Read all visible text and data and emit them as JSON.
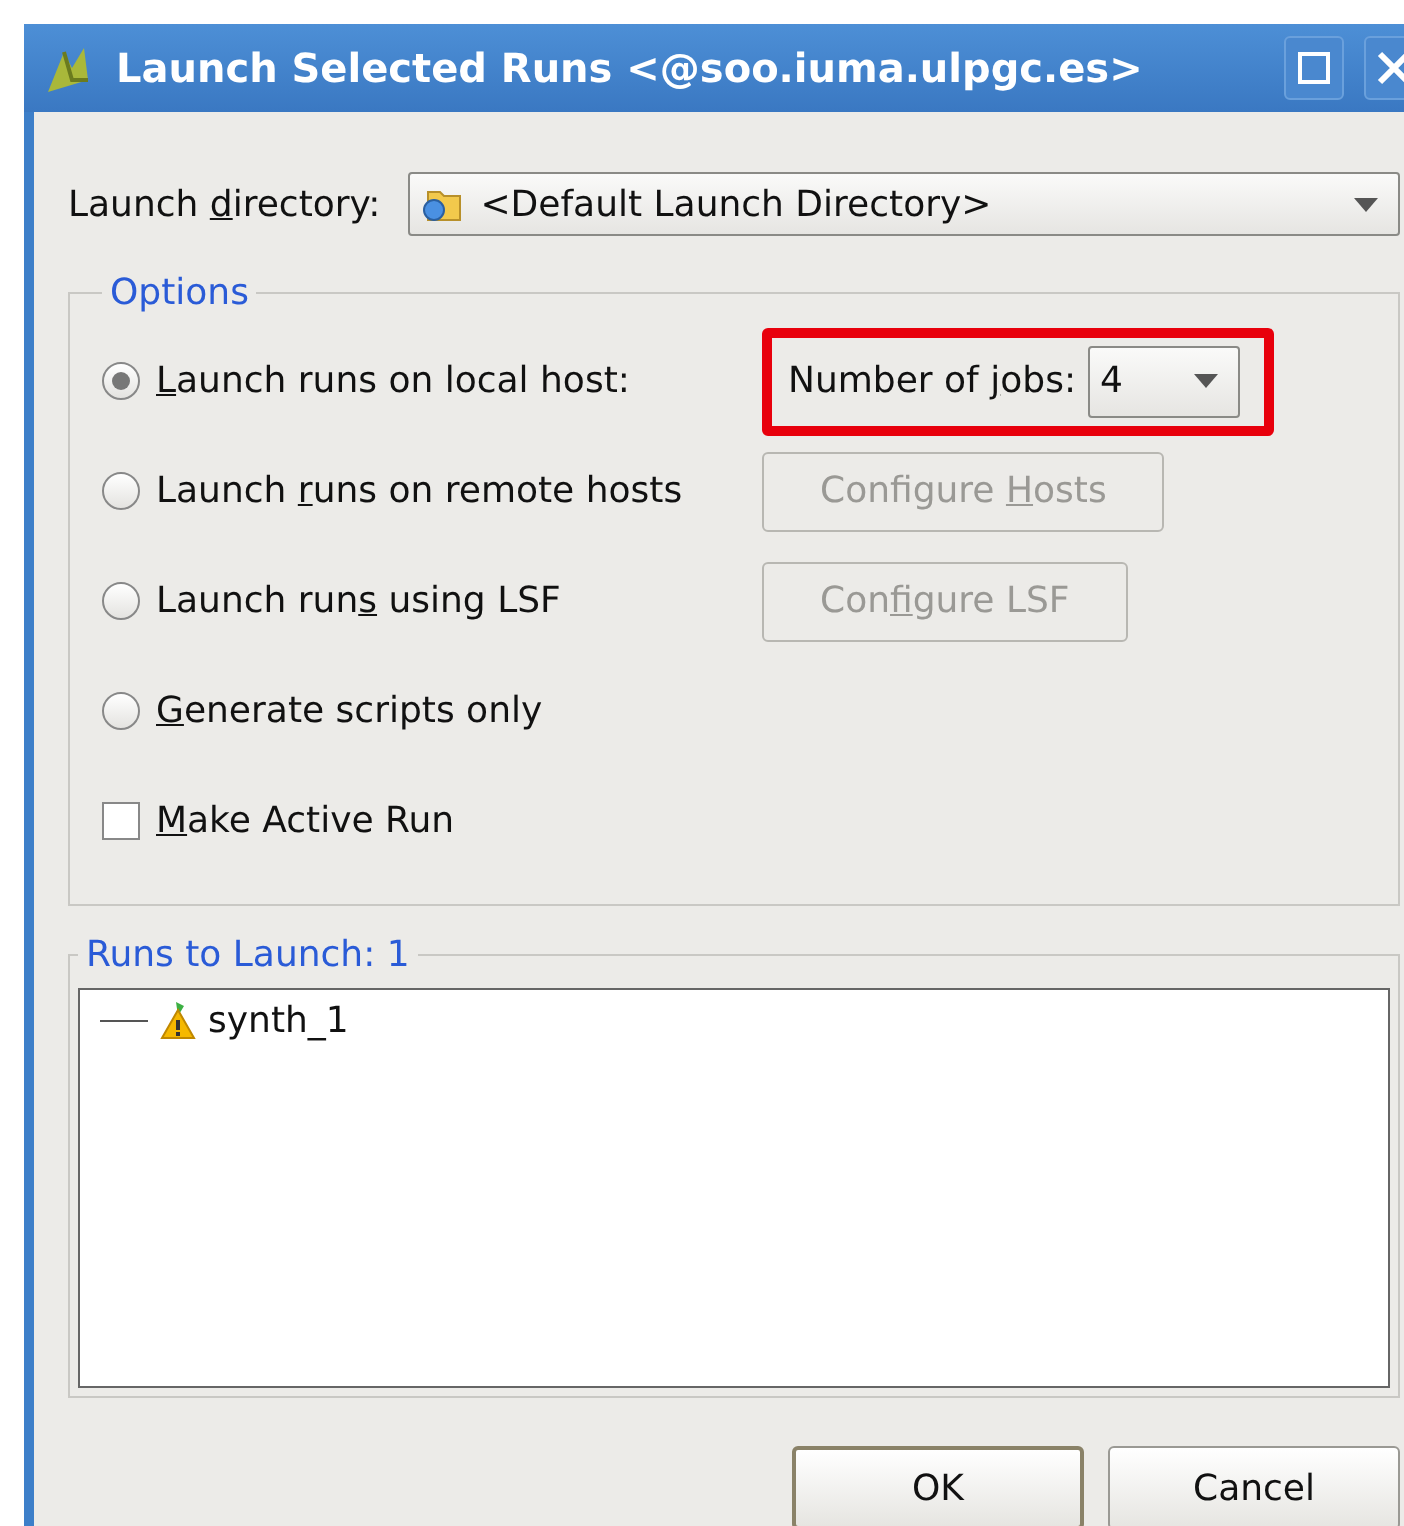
{
  "window": {
    "title": "Launch Selected Runs <@soo.iuma.ulpgc.es>"
  },
  "launch_directory": {
    "label": {
      "pre": "Launch ",
      "key": "d",
      "post": "irectory:"
    },
    "value": "<Default Launch Directory>"
  },
  "options": {
    "title": "Options",
    "choices": [
      {
        "label": {
          "key": "L",
          "post": "aunch runs on local host:"
        },
        "selected": true,
        "kind": "jobs",
        "jobs_label": {
          "pre": "Number of ",
          "key": "j",
          "post": "obs:"
        },
        "jobs_value": "4",
        "highlighted": true
      },
      {
        "label": {
          "pre": "Launch ",
          "key": "r",
          "post": "uns on remote hosts"
        },
        "selected": false,
        "kind": "button",
        "button": {
          "label": {
            "pre": "Configure ",
            "key": "H",
            "post": "osts"
          },
          "disabled": true
        }
      },
      {
        "label": {
          "pre": "Launch run",
          "key": "s",
          "post": " using LSF"
        },
        "selected": false,
        "kind": "button",
        "button": {
          "label": {
            "pre": "Con",
            "key": "f",
            "post": "igure LSF"
          },
          "disabled": true
        }
      },
      {
        "label": {
          "key": "G",
          "post": "enerate scripts only"
        },
        "selected": false,
        "kind": "plain"
      }
    ],
    "make_active_run": {
      "label": {
        "key": "M",
        "post": "ake Active Run"
      },
      "checked": false
    }
  },
  "runs": {
    "title": "Runs to Launch: 1",
    "items": [
      {
        "label": "synth_1"
      }
    ]
  },
  "buttons": [
    {
      "label": "OK",
      "default": true
    },
    {
      "label": "Cancel",
      "default": false
    }
  ]
}
